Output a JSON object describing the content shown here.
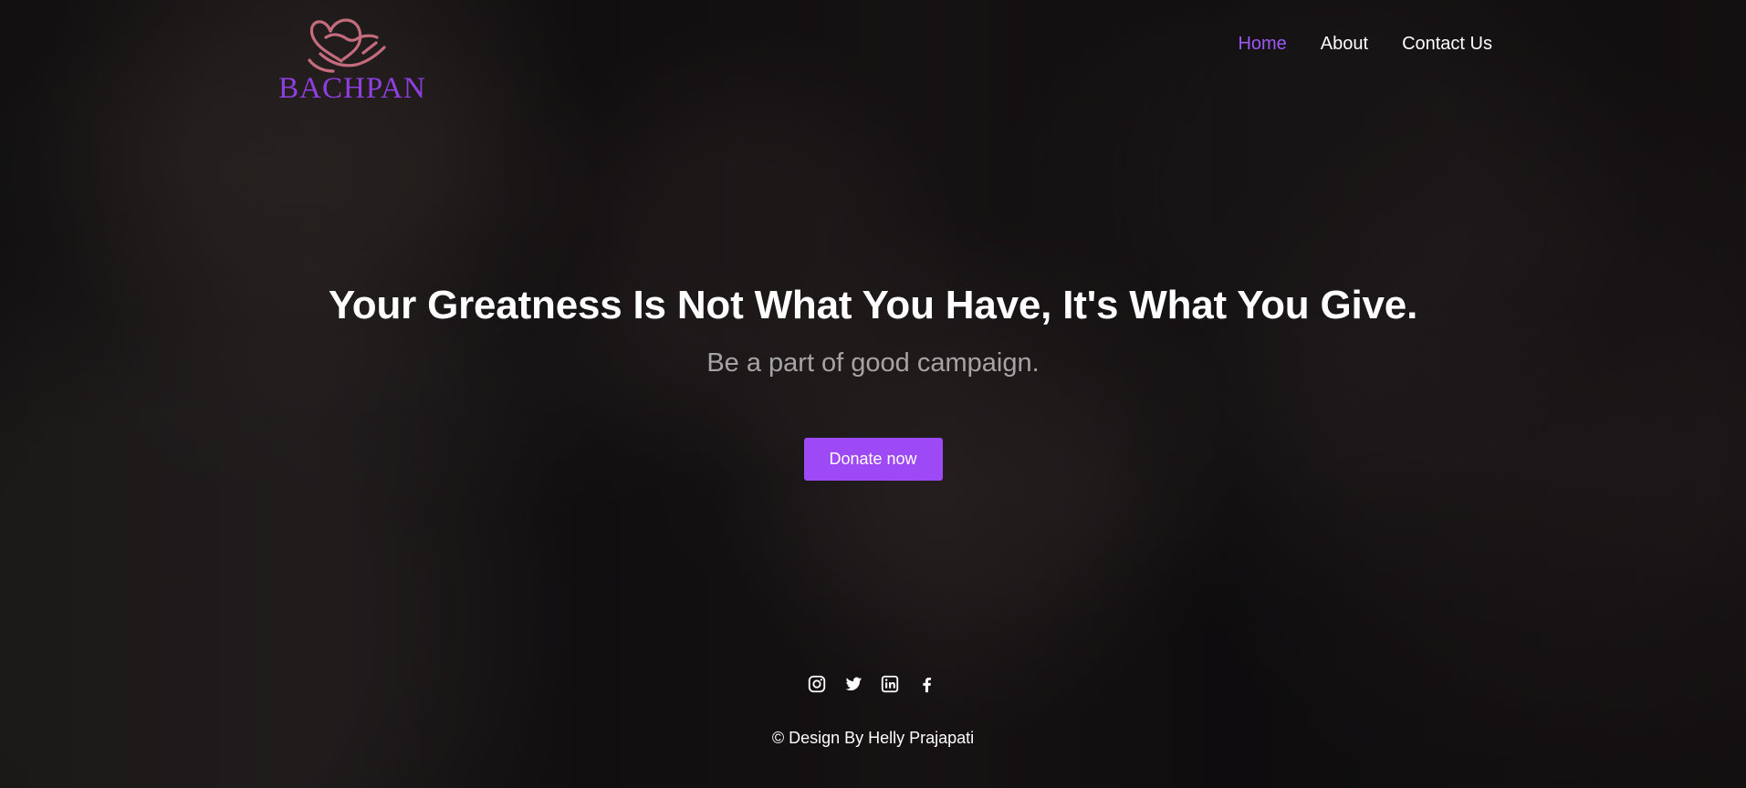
{
  "brand": {
    "name": "BACHPAN",
    "logo_icon": "heart-hand-icon",
    "logo_colors": {
      "icon": "#c46c7d",
      "text": "#8f3fe0"
    }
  },
  "navigation": {
    "items": [
      {
        "label": "Home",
        "active": true
      },
      {
        "label": "About",
        "active": false
      },
      {
        "label": "Contact Us",
        "active": false
      }
    ],
    "active_color": "#9b59f5"
  },
  "hero": {
    "headline": "Your Greatness Is Not What You Have, It's What You Give.",
    "subtitle": "Be a part of good campaign.",
    "button_label": "Donate now",
    "button_color": "#9d49f6"
  },
  "social_links": [
    {
      "icon": "instagram-icon"
    },
    {
      "icon": "twitter-icon"
    },
    {
      "icon": "linkedin-icon"
    },
    {
      "icon": "facebook-icon"
    }
  ],
  "footer": {
    "credit": "© Design By Helly Prajapati"
  }
}
